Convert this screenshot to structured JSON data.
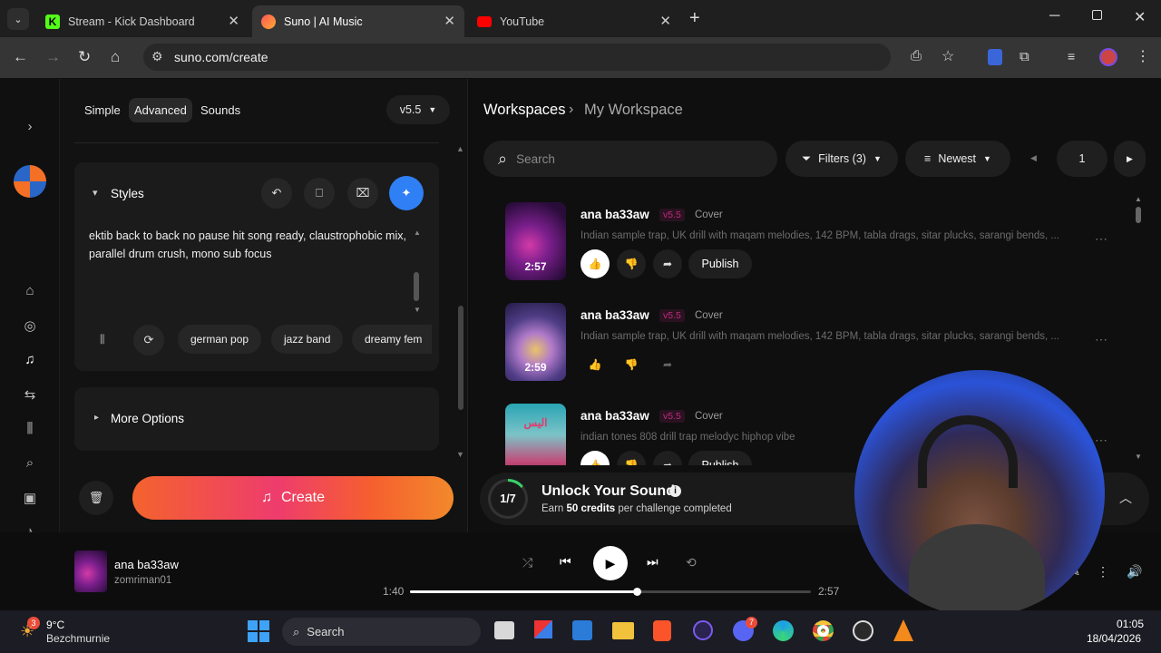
{
  "browser": {
    "tabs": [
      {
        "title": "Stream - Kick Dashboard",
        "icon": "kick-logo-icon",
        "active": false
      },
      {
        "title": "Suno | AI Music",
        "icon": "suno-logo-icon",
        "active": true
      },
      {
        "title": "YouTube",
        "icon": "youtube-logo-icon",
        "active": false
      }
    ],
    "url": "suno.com/create"
  },
  "create_panel": {
    "modes": [
      "Simple",
      "Advanced",
      "Sounds"
    ],
    "selected_mode": "Advanced",
    "model_version": "v5.5",
    "styles_label": "Styles",
    "styles_text": "ektib back to back no pause hit song ready, claustrophobic mix, parallel drum crush, mono sub focus",
    "style_suggestions": [
      "german pop",
      "jazz band",
      "dreamy fem"
    ],
    "more_options_label": "More Options",
    "create_label": "Create"
  },
  "workspace": {
    "breadcrumb_root": "Workspaces",
    "breadcrumb_current": "My Workspace",
    "search_placeholder": "Search",
    "filters_label": "Filters (3)",
    "sort_label": "Newest",
    "page": "1",
    "songs": [
      {
        "title": "ana ba33aw",
        "version": "v5.5",
        "tag": "Cover",
        "description": "Indian sample trap, UK drill with maqam melodies, 142 BPM, tabla drags, sitar plucks, sarangi bends, ...",
        "duration": "2:57",
        "publish_label": "Publish"
      },
      {
        "title": "ana ba33aw",
        "version": "v5.5",
        "tag": "Cover",
        "description": "Indian sample trap, UK drill with maqam melodies, 142 BPM, tabla drags, sitar plucks, sarangi bends, ...",
        "duration": "2:59",
        "publish_label": ""
      },
      {
        "title": "ana ba33aw",
        "version": "v5.5",
        "tag": "Cover",
        "description": "indian tones 808 drill trap melodyc hiphop vibe",
        "duration": "",
        "publish_label": "Publish"
      }
    ],
    "song3_art_text": "اليس",
    "challenge": {
      "progress": "1/7",
      "progress_fraction": 0.143,
      "title": "Unlock Your Sound",
      "subtitle_pre": "Earn",
      "subtitle_bold": "50 credits",
      "subtitle_post": "per challenge completed"
    }
  },
  "player": {
    "title": "ana ba33aw",
    "artist": "zomriman01",
    "elapsed": "1:40",
    "duration": "2:57",
    "progress_fraction": 0.565
  },
  "taskbar": {
    "weather_temp": "9°C",
    "weather_location": "Bezchmurnie",
    "weather_badge": "3",
    "search_label": "Search",
    "discord_badge": "7",
    "time": "01:05",
    "date": "18/04/2026"
  },
  "colors": {
    "accent_blue": "#2f7ff5",
    "create_gradient_start": "#f4632d",
    "create_gradient_end": "#f2892b",
    "version_tag": "#c02b7c"
  }
}
